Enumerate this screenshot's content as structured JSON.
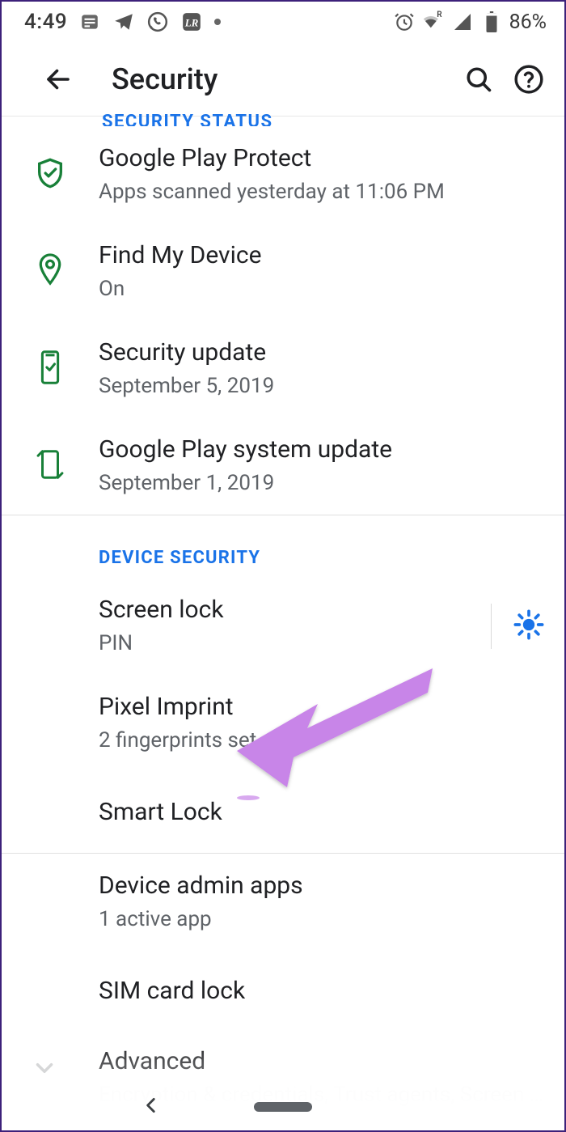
{
  "statusbar": {
    "time": "4:49",
    "battery_percent": "86%"
  },
  "appbar": {
    "title": "Security"
  },
  "partial_section_header": "SECURITY STATUS",
  "section1": {
    "items": [
      {
        "title": "Google Play Protect",
        "subtitle": "Apps scanned yesterday at 11:06 PM"
      },
      {
        "title": "Find My Device",
        "subtitle": "On"
      },
      {
        "title": "Security update",
        "subtitle": "September 5, 2019"
      },
      {
        "title": "Google Play system update",
        "subtitle": "September 1, 2019"
      }
    ]
  },
  "section2": {
    "header": "DEVICE SECURITY",
    "items": [
      {
        "title": "Screen lock",
        "subtitle": "PIN"
      },
      {
        "title": "Pixel Imprint",
        "subtitle": "2 fingerprints set up"
      },
      {
        "title": "Smart Lock",
        "subtitle": ""
      }
    ]
  },
  "section3": {
    "items": [
      {
        "title": "Device admin apps",
        "subtitle": "1 active app"
      },
      {
        "title": "SIM card lock",
        "subtitle": ""
      },
      {
        "title": "Advanced",
        "subtitle": "Encryption & credentials, Trust agents, Screen pinn.."
      }
    ]
  },
  "annotation": {
    "arrow_color": "#c885e8"
  }
}
